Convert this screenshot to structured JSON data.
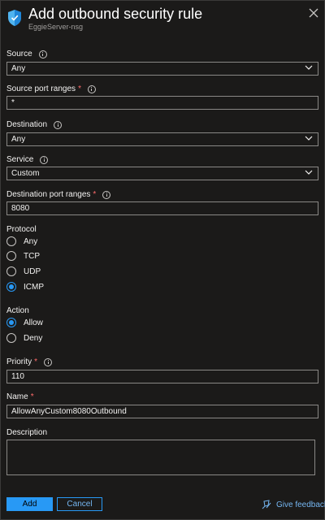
{
  "header": {
    "title": "Add outbound security rule",
    "subtitle": "EggieServer-nsg",
    "icon": "shield-icon",
    "close_icon": "close-icon"
  },
  "form": {
    "source": {
      "label": "Source",
      "value": "Any"
    },
    "source_port_ranges": {
      "label": "Source port ranges",
      "value": "*"
    },
    "destination": {
      "label": "Destination",
      "value": "Any"
    },
    "service": {
      "label": "Service",
      "value": "Custom"
    },
    "destination_port_ranges": {
      "label": "Destination port ranges",
      "value": "8080"
    },
    "protocol": {
      "label": "Protocol",
      "options": [
        "Any",
        "TCP",
        "UDP",
        "ICMP"
      ],
      "selected": "ICMP"
    },
    "action": {
      "label": "Action",
      "options": [
        "Allow",
        "Deny"
      ],
      "selected": "Allow"
    },
    "priority": {
      "label": "Priority",
      "value": "110"
    },
    "name": {
      "label": "Name",
      "value": "AllowAnyCustom8080Outbound"
    },
    "description": {
      "label": "Description",
      "value": ""
    }
  },
  "footer": {
    "add_label": "Add",
    "cancel_label": "Cancel",
    "feedback_label": "Give feedback"
  },
  "colors": {
    "background": "#1b1a19",
    "accent": "#2899f5",
    "link": "#75b6f1",
    "required": "#ff6b6b"
  }
}
